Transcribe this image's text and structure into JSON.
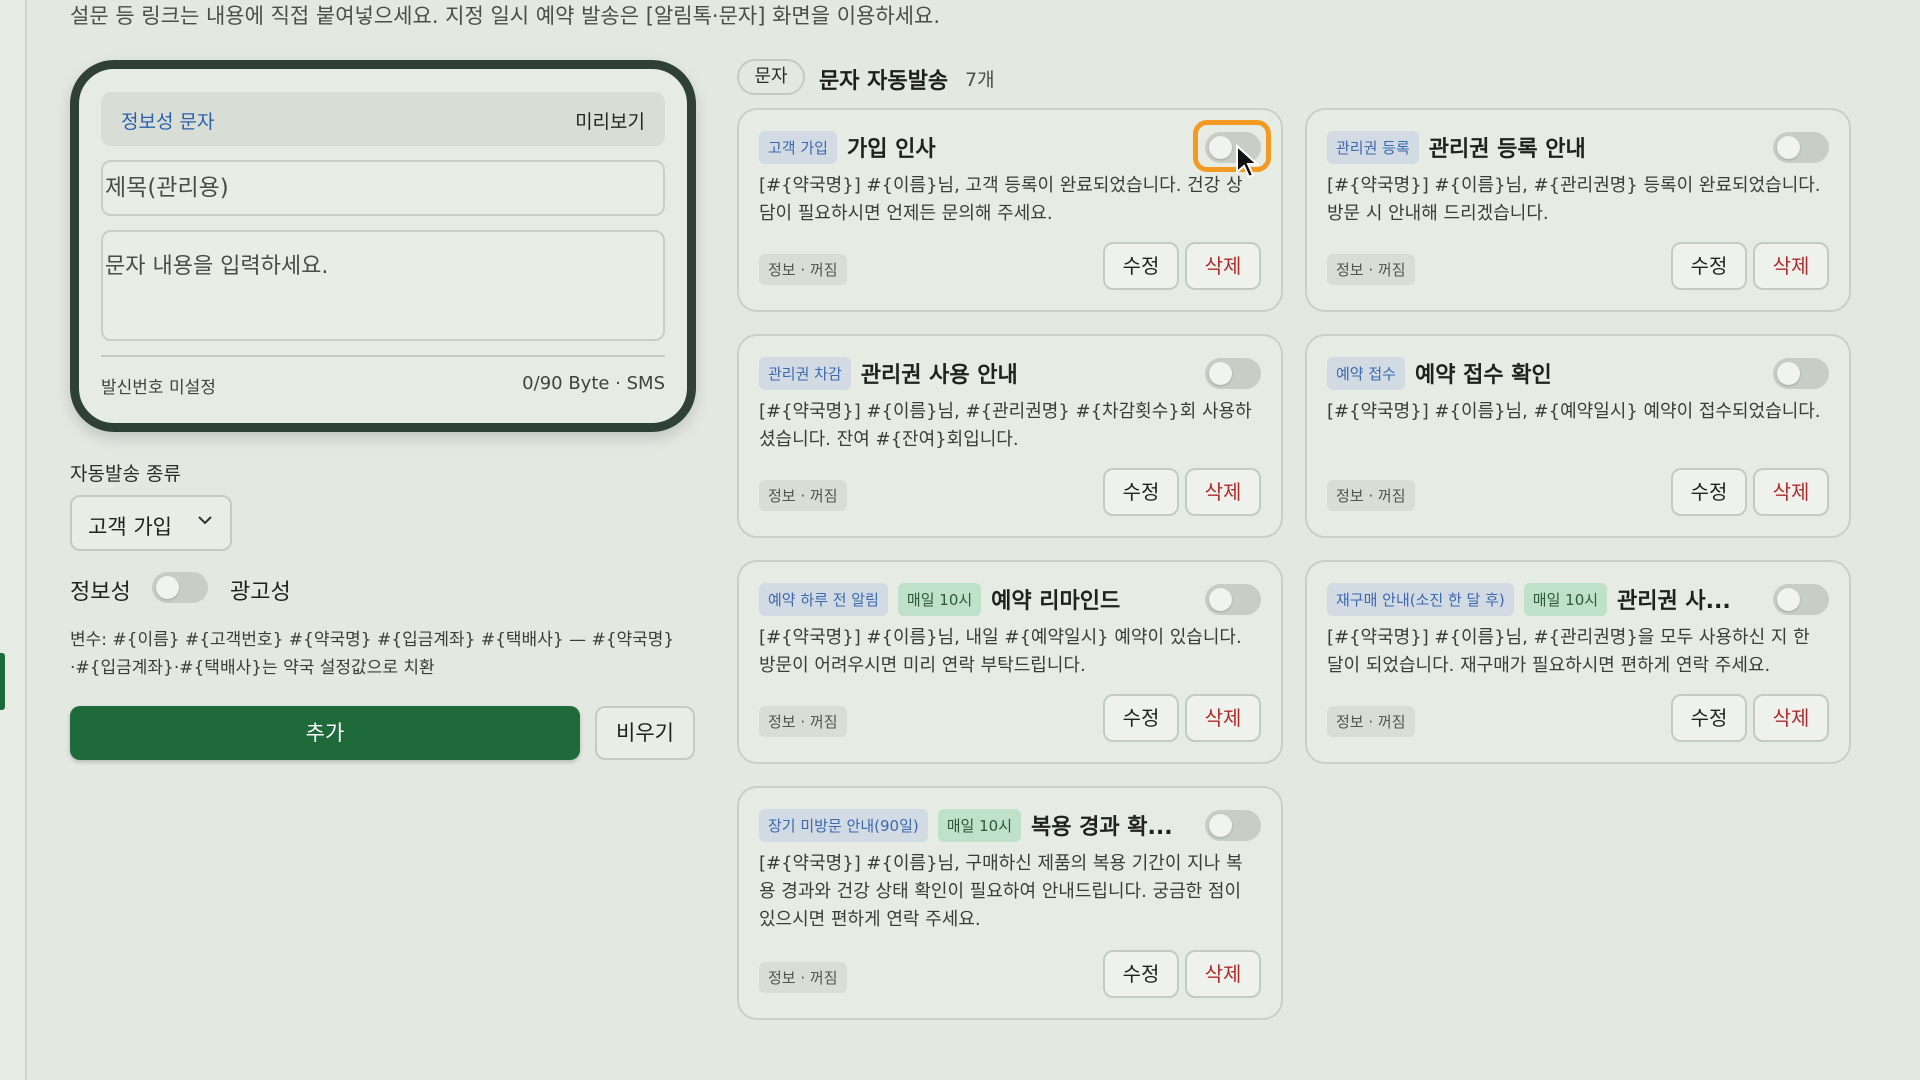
{
  "description_line": "설문 등 링크는 내용에 직접 붙여넣으세요. 지정 일시 예약 발송은 [알림톡·문자] 화면을 이용하세요.",
  "composer": {
    "type_label": "정보성 문자",
    "preview_label": "미리보기",
    "title_placeholder": "제목(관리용)",
    "body_placeholder": "문자 내용을 입력하세요.",
    "sender_status": "발신번호 미설정",
    "byte_count": "0/90 Byte · SMS"
  },
  "form": {
    "auto_send_type_label": "자동발송 종류",
    "auto_send_type_value": "고객 가입",
    "info_label": "정보성",
    "ad_label": "광고성",
    "variables_text": "변수: #{이름} #{고객번호} #{약국명} #{입금계좌} #{택배사} — #{약국명}·#{입금계좌}·#{택배사}는 약국 설정값으로 치환",
    "add_button": "추가",
    "clear_button": "비우기"
  },
  "list": {
    "chip": "문자",
    "title": "문자 자동발송",
    "count": "7개"
  },
  "cards": [
    {
      "tag": "고객 가입",
      "schedule": "",
      "title": "가입 인사",
      "body": "[#{약국명}] #{이름}님, 고객 등록이 완료되었습니다. 건강 상담이 필요하시면 언제든 문의해 주세요.",
      "status": "정보 · 꺼짐",
      "edit": "수정",
      "delete": "삭제"
    },
    {
      "tag": "관리권 등록",
      "schedule": "",
      "title": "관리권 등록 안내",
      "body": "[#{약국명}] #{이름}님, #{관리권명} 등록이 완료되었습니다. 방문 시 안내해 드리겠습니다.",
      "status": "정보 · 꺼짐",
      "edit": "수정",
      "delete": "삭제"
    },
    {
      "tag": "관리권 차감",
      "schedule": "",
      "title": "관리권 사용 안내",
      "body": "[#{약국명}] #{이름}님, #{관리권명} #{차감횟수}회 사용하셨습니다. 잔여 #{잔여}회입니다.",
      "status": "정보 · 꺼짐",
      "edit": "수정",
      "delete": "삭제"
    },
    {
      "tag": "예약 접수",
      "schedule": "",
      "title": "예약 접수 확인",
      "body": "[#{약국명}] #{이름}님, #{예약일시} 예약이 접수되었습니다.",
      "status": "정보 · 꺼짐",
      "edit": "수정",
      "delete": "삭제"
    },
    {
      "tag": "예약 하루 전 알림",
      "schedule": "매일 10시",
      "title": "예약 리마인드",
      "body": "[#{약국명}] #{이름}님, 내일 #{예약일시} 예약이 있습니다. 방문이 어려우시면 미리 연락 부탁드립니다.",
      "status": "정보 · 꺼짐",
      "edit": "수정",
      "delete": "삭제"
    },
    {
      "tag": "재구매 안내(소진 한 달 후)",
      "schedule": "매일 10시",
      "title": "관리권 사...",
      "body": "[#{약국명}] #{이름}님, #{관리권명}을 모두 사용하신 지 한 달이 되었습니다. 재구매가 필요하시면 편하게 연락 주세요.",
      "status": "정보 · 꺼짐",
      "edit": "수정",
      "delete": "삭제"
    },
    {
      "tag": "장기 미방문 안내(90일)",
      "schedule": "매일 10시",
      "title": "복용 경과 확...",
      "body": "[#{약국명}] #{이름}님, 구매하신 제품의 복용 기간이 지나 복용 경과와 건강 상태 확인이 필요하여 안내드립니다. 궁금한 점이 있으시면 편하게 연락 주세요.",
      "status": "정보 · 꺼짐",
      "edit": "수정",
      "delete": "삭제"
    }
  ],
  "colors": {
    "primary": "#1e6a3a",
    "danger": "#b02b2b",
    "focus": "#f29a22",
    "tag_blue": "#3c69ad"
  }
}
